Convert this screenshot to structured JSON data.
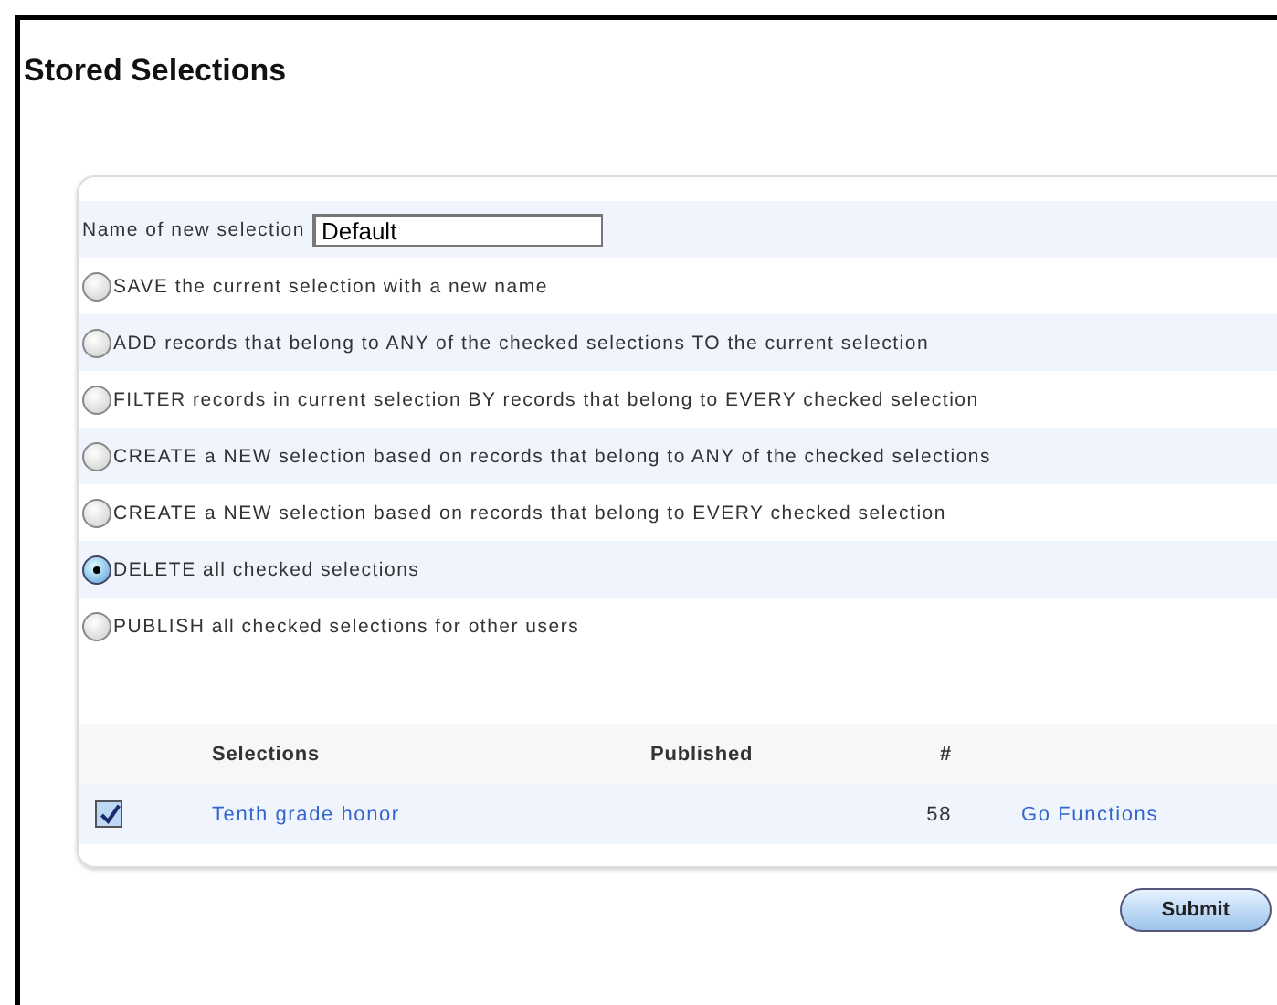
{
  "title": "Stored Selections",
  "name_field": {
    "label": "Name of new selection",
    "value": "Default"
  },
  "options": [
    {
      "label": "SAVE the current selection with a new name",
      "selected": false
    },
    {
      "label": "ADD records that belong to ANY of the checked selections TO the current selection",
      "selected": false
    },
    {
      "label": "FILTER records in current selection BY records that belong to EVERY checked selection",
      "selected": false
    },
    {
      "label": "CREATE a NEW selection based on records that belong to ANY of the checked selections",
      "selected": false
    },
    {
      "label": "CREATE a NEW selection based on records that belong to EVERY checked selection",
      "selected": false
    },
    {
      "label": "DELETE all checked selections",
      "selected": true
    },
    {
      "label": "PUBLISH all checked selections for other users",
      "selected": false
    }
  ],
  "table": {
    "columns": [
      "Selections",
      "Published",
      "#"
    ],
    "rows": [
      {
        "checked": true,
        "name": "Tenth grade honor",
        "count": "58",
        "link": "Go Functions"
      }
    ]
  },
  "submit": "Submit"
}
